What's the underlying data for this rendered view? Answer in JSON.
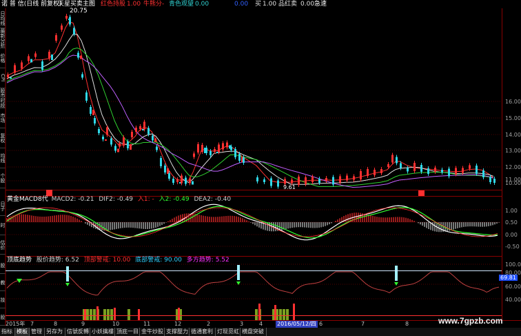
{
  "header": {
    "left_text": "诺 普 信(日线 前复权)",
    "indicator_name": "天星买卖主图",
    "items": [
      {
        "label": "红色持股",
        "value": "1.00",
        "color": "#ff3030"
      },
      {
        "label": "牛熊分",
        "value": "-",
        "color": "#ff3030"
      },
      {
        "label": "青色观望",
        "value": "0.00",
        "color": "#30d0d0"
      },
      {
        "label": "",
        "value": "0.00",
        "color": "#3060ff"
      },
      {
        "label": "买",
        "value": "1.00",
        "color": "#e0e0e0"
      },
      {
        "label": "品红卖",
        "value": "0.00",
        "color": "#e0e0e0"
      },
      {
        "label": "急速",
        "value": "",
        "color": "#ffffff"
      }
    ]
  },
  "left_sidebar_main": [
    "日均线",
    "最新分析",
    "价格",
    "CPI",
    "股市时段",
    "市场",
    "复权",
    "均线",
    "个股"
  ],
  "left_sidebar_mid": [
    "日子",
    "时",
    "估价"
  ],
  "left_sidebar_low": [
    "股",
    "教",
    "技",
    "股"
  ],
  "main_chart": {
    "high_label": "20.75",
    "low_label": "9.61",
    "y_ticks": [
      "16.00",
      "15.00",
      "14.00",
      "13.00",
      "12.00",
      "11.00",
      "10.00"
    ]
  },
  "macd_panel": {
    "title": "黄金MACD8代",
    "items": [
      {
        "text": "MACD2: -0.21",
        "color": "#d0d0d0"
      },
      {
        "text": "DIF2: -0.49",
        "color": "#d0d0d0"
      },
      {
        "text": "入1: -",
        "color": "#ff3030"
      },
      {
        "text": "入2: -0.49",
        "color": "#30ff30"
      },
      {
        "text": "DEA2: -0.40",
        "color": "#d0d0d0"
      }
    ],
    "y_ticks": [
      "1.00",
      "0.50",
      "0.00",
      "-0.50"
    ]
  },
  "trend_panel": {
    "title": "顶底趋势",
    "items": [
      {
        "text": "股价趋势: 6.52",
        "color": "#d0d0d0"
      },
      {
        "text": "顶部警戒: 10.00",
        "color": "#ff3030"
      },
      {
        "text": "底部警戒: 90.00",
        "color": "#30d0ff"
      },
      {
        "text": "多方趋势: 5.52",
        "color": "#ff30ff"
      }
    ],
    "y_ticks": [
      "100.00",
      "80.00",
      "60.00",
      "40.00"
    ],
    "value_tag": "69.81"
  },
  "date_axis": {
    "labels": [
      "2015年",
      "7",
      "8",
      "9",
      "10",
      "11",
      "12",
      "2",
      "3",
      "4",
      "5",
      "6",
      "7",
      "8"
    ],
    "cursor_date": "2016/05/12/四"
  },
  "bottom_tabs": [
    "指标",
    "模板",
    "管理",
    "另存为",
    "信號反轉",
    "小妖擒樓",
    "頂底一目",
    "金牛炒股",
    "支撑壓力",
    "循通套利",
    "灯现觅虹",
    "横盘突破"
  ],
  "watermark": "www.7gpzb.com",
  "colors": {
    "up": "#ff3030",
    "down": "#30d8e8",
    "grid": "#7a0000"
  }
}
